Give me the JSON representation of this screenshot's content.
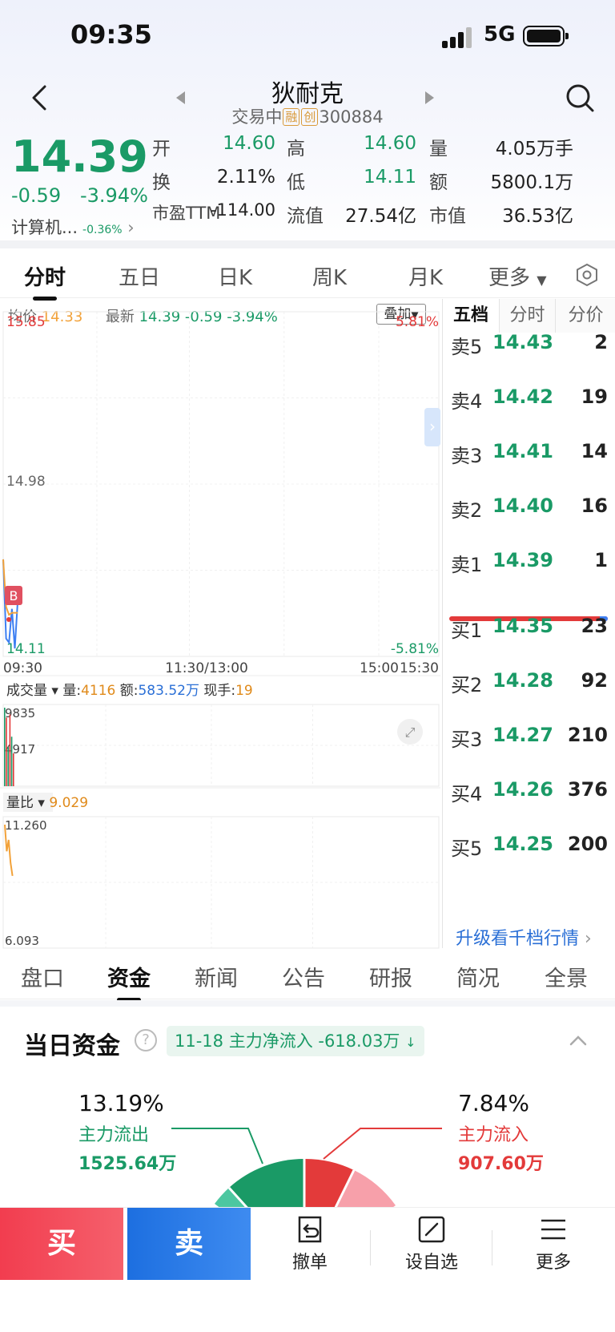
{
  "status_bar": {
    "time": "09:35",
    "network": "5G"
  },
  "header": {
    "stock_name": "狄耐克",
    "status": "交易中",
    "badge_margin": "融",
    "badge_chinext": "创",
    "code": "300884"
  },
  "quote": {
    "price": "14.39",
    "change": "-0.59",
    "change_pct": "-3.94%",
    "sector_name": "计算机...",
    "sector_change": "-0.36%",
    "fields": [
      {
        "label": "开",
        "value": "14.60"
      },
      {
        "label": "高",
        "value": "14.60"
      },
      {
        "label": "量",
        "value": "4.05万手"
      },
      {
        "label": "换",
        "value": "2.11%"
      },
      {
        "label": "低",
        "value": "14.11"
      },
      {
        "label": "额",
        "value": "5800.1万"
      },
      {
        "label": "市盈TTM",
        "value": "-114.00"
      },
      {
        "label": "流值",
        "value": "27.54亿"
      },
      {
        "label": "市值",
        "value": "36.53亿"
      }
    ]
  },
  "period_tabs": [
    "分时",
    "五日",
    "日K",
    "周K",
    "月K",
    "更多"
  ],
  "chart_info": {
    "avg_label": "均价",
    "avg_value": "14.33",
    "latest_label": "最新",
    "latest_value": "14.39",
    "latest_change": "-0.59",
    "latest_pct": "-3.94%",
    "overlay_label": "叠加",
    "buy_marker": "B"
  },
  "volume_panel": {
    "selector": "成交量",
    "vol_label": "量:",
    "vol_value": "4116",
    "amt_label": "额:",
    "amt_value": "583.52万",
    "hand_label": "现手:",
    "hand_value": "19"
  },
  "ratio_panel": {
    "selector": "量比",
    "value": "9.029"
  },
  "chart_data": [
    {
      "type": "line",
      "title": "分时",
      "x_ticks": [
        "09:30",
        "11:30/13:00",
        "15:00",
        "15:30"
      ],
      "y_left_ticks": [
        "15.85",
        "14.98",
        "14.11"
      ],
      "y_right_ticks": [
        "5.81%",
        "-5.81%"
      ],
      "ylim": [
        14.11,
        15.85
      ],
      "series": [
        {
          "name": "最新",
          "color": "#3d7ff2",
          "x": [
            "09:30",
            "09:31",
            "09:32",
            "09:33",
            "09:34",
            "09:35"
          ],
          "values": [
            14.6,
            14.2,
            14.18,
            14.35,
            14.15,
            14.39
          ]
        },
        {
          "name": "均价",
          "color": "#f2a23a",
          "x": [
            "09:30",
            "09:31",
            "09:32",
            "09:33",
            "09:34",
            "09:35"
          ],
          "values": [
            14.6,
            14.36,
            14.32,
            14.33,
            14.33,
            14.33
          ]
        }
      ]
    },
    {
      "type": "bar",
      "title": "成交量",
      "y_ticks": [
        "9835",
        "4917"
      ],
      "x": [
        "09:30",
        "09:31",
        "09:32",
        "09:33",
        "09:34",
        "09:35"
      ],
      "values": [
        9835,
        8600,
        4900,
        9000,
        6200,
        4116
      ],
      "colors": [
        "#1a9a66",
        "#e33a3a",
        "#1a9a66",
        "#e33a3a",
        "#1a9a66",
        "#e33a3a"
      ]
    },
    {
      "type": "line",
      "title": "量比",
      "y_ticks": [
        "11.260",
        "6.093"
      ],
      "ylim": [
        6.093,
        11.26
      ],
      "x": [
        "09:31",
        "09:32",
        "09:33",
        "09:34",
        "09:35"
      ],
      "values": [
        11.26,
        10.1,
        10.6,
        9.6,
        9.029
      ]
    }
  ],
  "order_book": {
    "tabs": [
      "五档",
      "分时",
      "分价"
    ],
    "asks": [
      {
        "label": "卖5",
        "price": "14.43",
        "vol": "2"
      },
      {
        "label": "卖4",
        "price": "14.42",
        "vol": "19"
      },
      {
        "label": "卖3",
        "price": "14.41",
        "vol": "14"
      },
      {
        "label": "卖2",
        "price": "14.40",
        "vol": "16"
      },
      {
        "label": "卖1",
        "price": "14.39",
        "vol": "1"
      }
    ],
    "bids": [
      {
        "label": "买1",
        "price": "14.35",
        "vol": "23"
      },
      {
        "label": "买2",
        "price": "14.28",
        "vol": "92"
      },
      {
        "label": "买3",
        "price": "14.27",
        "vol": "210"
      },
      {
        "label": "买4",
        "price": "14.26",
        "vol": "376"
      },
      {
        "label": "买5",
        "price": "14.25",
        "vol": "200"
      }
    ],
    "upgrade_label": "升级看千档行情"
  },
  "lower_tabs": [
    "盘口",
    "资金",
    "新闻",
    "公告",
    "研报",
    "简况",
    "全景"
  ],
  "capital": {
    "title": "当日资金",
    "summary": "11-18 主力净流入 -618.03万",
    "outflow_pct": "13.19%",
    "outflow_label": "主力流出",
    "outflow_value": "1525.64万",
    "inflow_pct": "7.84%",
    "inflow_label": "主力流入",
    "inflow_value": "907.60万"
  },
  "bottom_bar": {
    "buy": "买",
    "sell": "卖",
    "cancel": "撤单",
    "watchlist": "设自选",
    "more": "更多"
  },
  "colors": {
    "up": "#e33a3a",
    "down": "#1a9a66",
    "accent": "#2a6fd6"
  }
}
